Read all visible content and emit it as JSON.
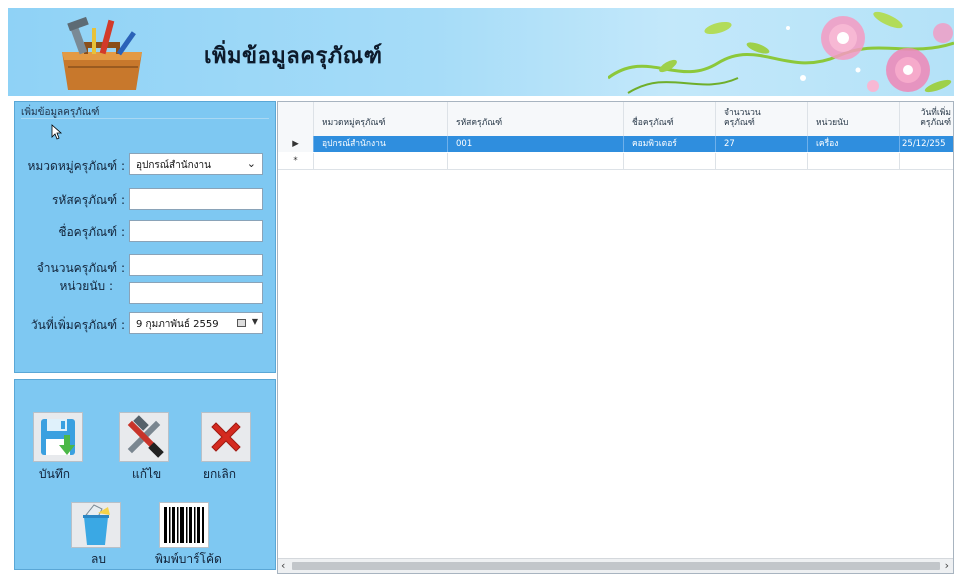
{
  "header": {
    "title": "เพิ่มข้อมูลครุภัณฑ์",
    "logo_icon": "toolbox-icon"
  },
  "form": {
    "group_title": "เพิ่มข้อมูลครุภัณฑ์",
    "category_label": "หมวดหมู่ครุภัณฑ์ :",
    "category_value": "อุปกรณ์สำนักงาน",
    "code_label": "รหัสครุภัณฑ์ :",
    "code_value": "",
    "name_label": "ชื่อครุภัณฑ์ :",
    "name_value": "",
    "quantity_label": "จำนวนครุภัณฑ์ :",
    "quantity_value": "",
    "unit_label": "หน่วยนับ :",
    "unit_value": "",
    "date_label": "วันที่เพิ่มครุภัณฑ์ :",
    "date_value": "9  กุมภาพันธ์  2559"
  },
  "buttons": {
    "save": "บันทึก",
    "edit": "แก้ไข",
    "cancel": "ยกเลิก",
    "delete": "ลบ",
    "barcode": "พิมพ์บาร์โค้ด"
  },
  "grid": {
    "columns": [
      "หมวดหมู่ครุภัณฑ์",
      "รหัสครุภัณฑ์",
      "ชื่อครุภัณฑ์",
      "จำนวนวน ครุภัณฑ์",
      "หน่วยนับ",
      "วันที่เพิ่ม ครุภัณฑ์"
    ],
    "rows": [
      [
        "อุปกรณ์สำนักงาน",
        "001",
        "คอมพิวเตอร์",
        "27",
        "เครื่อง",
        "25/12/255"
      ]
    ],
    "current_row_marker": "▶",
    "new_row_marker": "*",
    "selected_color": "#2f8ede"
  },
  "colors": {
    "panel": "#7ec8f2",
    "header": "#a6dcf8"
  }
}
